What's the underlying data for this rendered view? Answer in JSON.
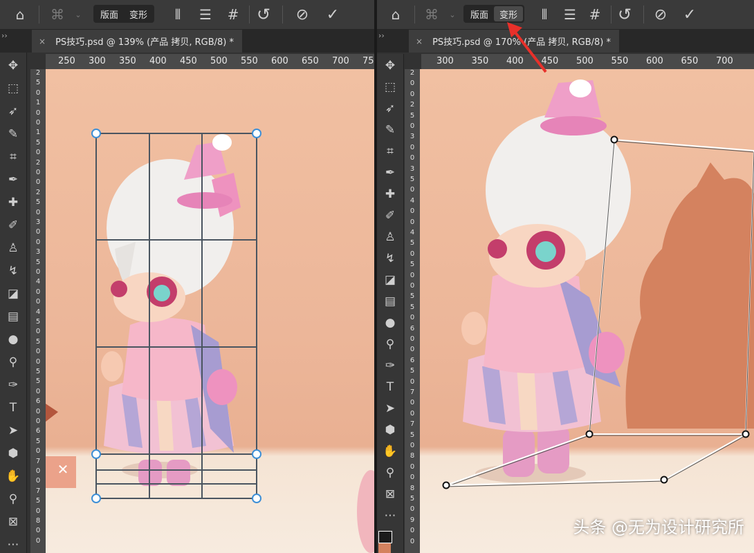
{
  "left": {
    "options": {
      "home_icon": "⌂",
      "warp_icon": "⌘",
      "seg_layout": "版面",
      "seg_transform": "变形",
      "split_v_icon": "⦀",
      "split_h_icon": "☰",
      "grid_icon": "#",
      "reset_icon": "↺",
      "cancel_icon": "⊘",
      "commit_icon": "✓"
    },
    "tab": {
      "title": "PS技巧.psd @ 139% (产品 拷贝, RGB/8) *",
      "close": "×"
    },
    "hruler": [
      "250",
      "300",
      "350",
      "400",
      "450",
      "500",
      "550",
      "600",
      "650",
      "700",
      "75"
    ],
    "vruler": [
      "2",
      "5",
      "0",
      "1",
      "0",
      "0",
      "1",
      "5",
      "0",
      "2",
      "0",
      "0",
      "2",
      "5",
      "0",
      "3",
      "0",
      "0",
      "3",
      "5",
      "0",
      "4",
      "0",
      "0",
      "4",
      "5",
      "0",
      "5",
      "0",
      "0",
      "5",
      "5",
      "0",
      "6",
      "0",
      "0",
      "6",
      "5",
      "0",
      "7",
      "0",
      "0",
      "7",
      "5",
      "0",
      "8",
      "0",
      "0"
    ]
  },
  "right": {
    "options": {
      "home_icon": "⌂",
      "warp_icon": "⌘",
      "seg_layout": "版面",
      "seg_transform": "变形",
      "split_v_icon": "⦀",
      "split_h_icon": "☰",
      "grid_icon": "#",
      "reset_icon": "↺",
      "cancel_icon": "⊘",
      "commit_icon": "✓"
    },
    "tab": {
      "title": "PS技巧.psd @ 170% (产品 拷贝, RGB/8) *",
      "close": "×"
    },
    "hruler": [
      "300",
      "350",
      "400",
      "450",
      "500",
      "550",
      "600",
      "650",
      "700"
    ],
    "vruler": [
      "2",
      "0",
      "0",
      "2",
      "5",
      "0",
      "3",
      "0",
      "0",
      "3",
      "5",
      "0",
      "4",
      "0",
      "0",
      "4",
      "5",
      "0",
      "5",
      "0",
      "0",
      "5",
      "5",
      "0",
      "6",
      "0",
      "0",
      "6",
      "5",
      "0",
      "7",
      "0",
      "0",
      "7",
      "5",
      "0",
      "8",
      "0",
      "0",
      "8",
      "5",
      "0",
      "9",
      "0",
      "0"
    ]
  },
  "tools": [
    {
      "name": "move-tool",
      "glyph": "✥"
    },
    {
      "name": "marquee-tool",
      "glyph": "⬚"
    },
    {
      "name": "lasso-tool",
      "glyph": "➶"
    },
    {
      "name": "quick-select-tool",
      "glyph": "✎"
    },
    {
      "name": "crop-tool",
      "glyph": "⌗"
    },
    {
      "name": "eyedropper-tool",
      "glyph": "✒"
    },
    {
      "name": "healing-tool",
      "glyph": "✚"
    },
    {
      "name": "brush-tool",
      "glyph": "✐"
    },
    {
      "name": "stamp-tool",
      "glyph": "♙"
    },
    {
      "name": "history-brush-tool",
      "glyph": "↯"
    },
    {
      "name": "eraser-tool",
      "glyph": "◪"
    },
    {
      "name": "gradient-tool",
      "glyph": "▤"
    },
    {
      "name": "blur-tool",
      "glyph": "●"
    },
    {
      "name": "dodge-tool",
      "glyph": "⚲"
    },
    {
      "name": "pen-tool",
      "glyph": "✑"
    },
    {
      "name": "type-tool",
      "glyph": "T"
    },
    {
      "name": "path-select-tool",
      "glyph": "➤"
    },
    {
      "name": "shape-tool",
      "glyph": "⬢"
    },
    {
      "name": "hand-tool",
      "glyph": "✋"
    },
    {
      "name": "zoom-tool",
      "glyph": "⚲"
    },
    {
      "name": "frame-tool",
      "glyph": "⊠"
    },
    {
      "name": "more-tools",
      "glyph": "⋯"
    }
  ],
  "watermark": "头条 @无为设计研究所",
  "colors": {
    "accent_arrow": "#e8302a",
    "grid_line": "#4a5560",
    "handle_blue": "#3d8fd6",
    "shadow": "#d4825f"
  }
}
